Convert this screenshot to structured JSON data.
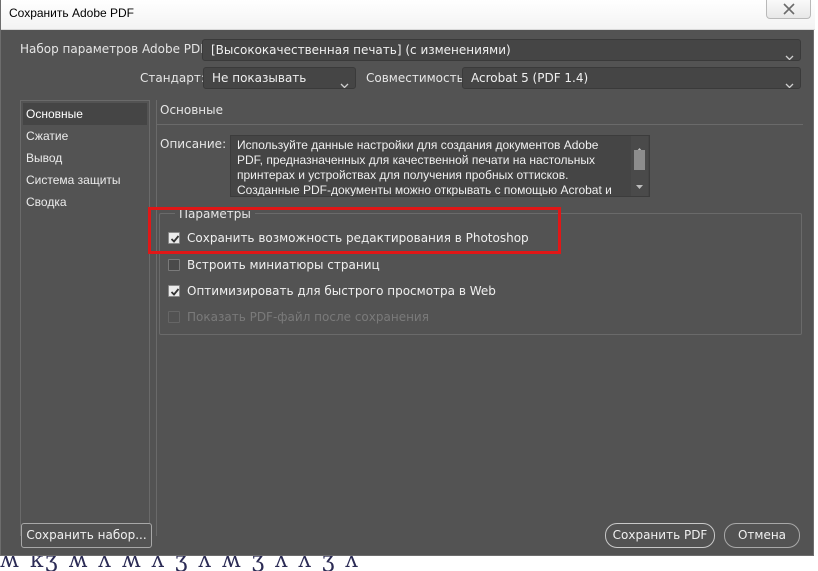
{
  "window": {
    "title": "Сохранить Adobe PDF"
  },
  "preset": {
    "label": "Набор параметров Adobe PDF:",
    "value": "[Высококачественная печать] (с изменениями)"
  },
  "standard": {
    "label": "Стандарт:",
    "value": "Не показывать"
  },
  "compatibility": {
    "label": "Совместимость:",
    "value": "Acrobat 5 (PDF 1.4)"
  },
  "sidebar": {
    "items": [
      {
        "label": "Основные",
        "active": true
      },
      {
        "label": "Сжатие"
      },
      {
        "label": "Вывод"
      },
      {
        "label": "Система защиты"
      },
      {
        "label": "Сводка"
      }
    ]
  },
  "section": {
    "title": "Основные"
  },
  "description": {
    "label": "Описание:",
    "text": "Используйте данные настройки для создания документов Adobe PDF, предназначенных для качественной печати на настольных принтерах и устройствах для получения пробных оттисков. Созданные PDF-документы можно  открывать с помощью Acrobat и"
  },
  "params": {
    "legend": "Параметры",
    "options": [
      {
        "label": "Сохранить возможность редактирования в Photoshop",
        "checked": true,
        "enabled": true
      },
      {
        "label": "Встроить миниатюры страниц",
        "checked": false,
        "enabled": true
      },
      {
        "label": "Оптимизировать для быстрого просмотра в Web",
        "checked": true,
        "enabled": true
      },
      {
        "label": "Показать PDF-файл после сохранения",
        "checked": false,
        "enabled": false
      }
    ]
  },
  "buttons": {
    "save_preset": "Сохранить набор...",
    "save_pdf": "Сохранить PDF",
    "cancel": "Отмена"
  },
  "colors": {
    "highlight": "#e11717",
    "panel": "#535353",
    "field": "#454545"
  }
}
